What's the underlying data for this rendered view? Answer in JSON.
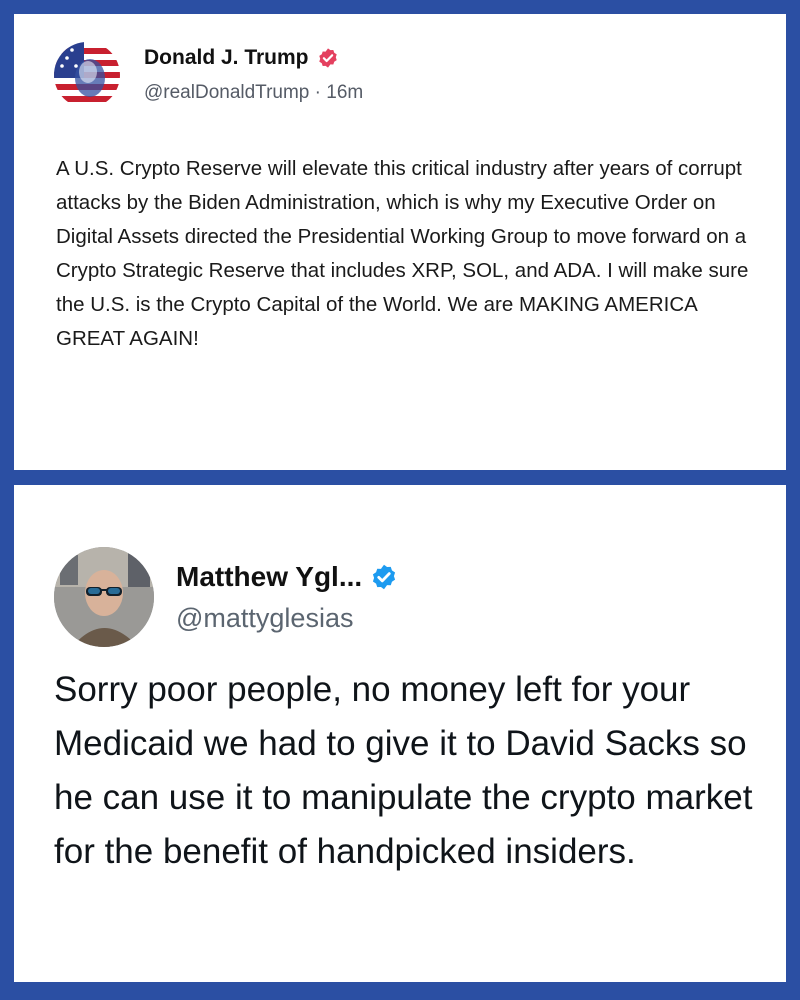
{
  "posts": [
    {
      "author_name": "Donald J. Trump",
      "handle": "@realDonaldTrump",
      "separator": "·",
      "time_ago": "16m",
      "verified_color": "#e4405f",
      "avatar_icon": "flag-portrait-avatar",
      "text": "A U.S. Crypto Reserve will elevate this critical industry after years of corrupt attacks by the Biden Administration, which is why my Executive Order on Digital Assets directed the Presidential Working Group to move forward on a Crypto Strategic Reserve that includes XRP, SOL, and ADA. I will make sure the U.S. is the Crypto Capital of the World. We are MAKING AMERICA GREAT AGAIN!"
    },
    {
      "author_name": "Matthew Ygl...",
      "handle": "@mattyglesias",
      "verified_color": "#1d9bf0",
      "avatar_icon": "person-sunglasses-avatar",
      "text": "Sorry poor people, no money left for your Medicaid we had to give it to David Sacks so he can use it to manipulate the crypto market for the benefit of handpicked insiders."
    }
  ],
  "colors": {
    "frame": "#2b4fa3",
    "panel": "#ffffff"
  }
}
